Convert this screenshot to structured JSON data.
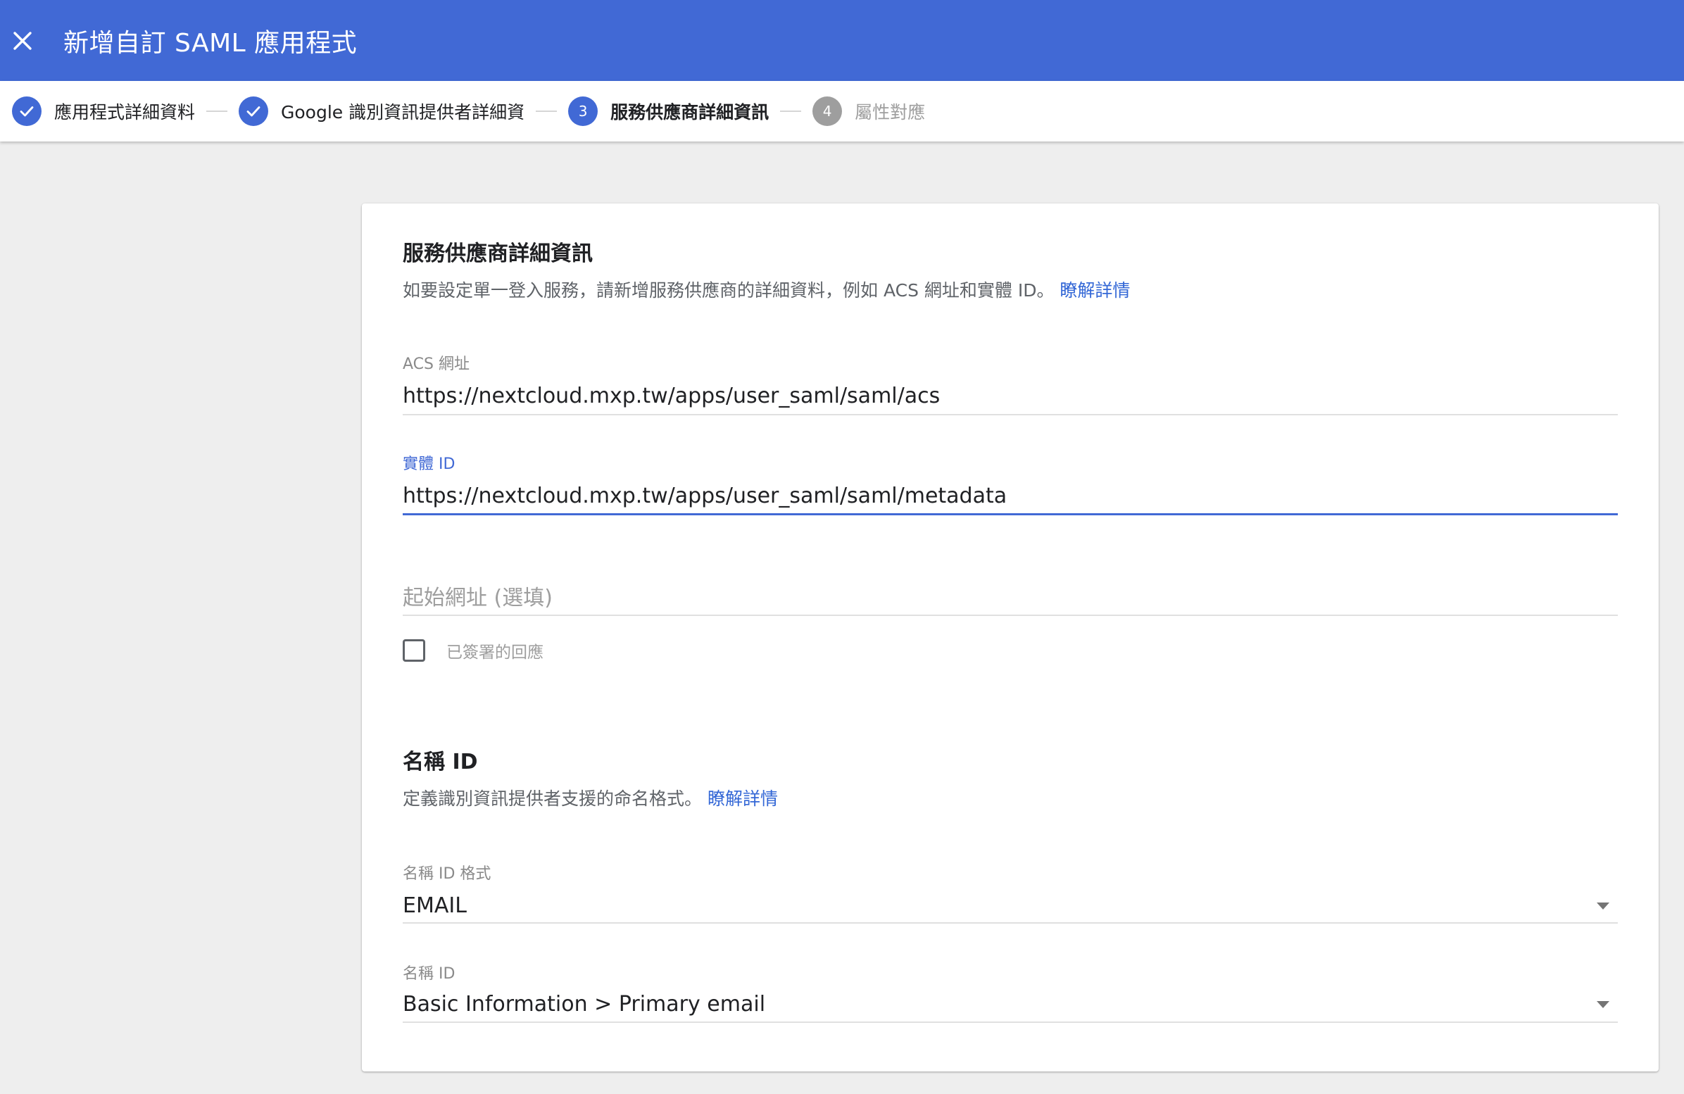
{
  "appbar": {
    "title": "新增自訂 SAML 應用程式",
    "close_icon": "close-icon"
  },
  "stepper": {
    "steps": [
      {
        "label": "應用程式詳細資料",
        "state": "done",
        "marker": "✓"
      },
      {
        "label": "Google 識別資訊提供者詳細資",
        "state": "done",
        "marker": "✓"
      },
      {
        "label": "服務供應商詳細資訊",
        "state": "active",
        "marker": "3"
      },
      {
        "label": "屬性對應",
        "state": "pending",
        "marker": "4"
      }
    ]
  },
  "service_provider": {
    "title": "服務供應商詳細資訊",
    "description": "如要設定單一登入服務，請新增服務供應商的詳細資料，例如 ACS 網址和實體 ID。",
    "learn_more": "瞭解詳情",
    "acs_label": "ACS 網址",
    "acs_value": "https://nextcloud.mxp.tw/apps/user_saml/saml/acs",
    "entity_label": "實體 ID",
    "entity_value": "https://nextcloud.mxp.tw/apps/user_saml/saml/metadata",
    "start_url_placeholder": "起始網址 (選填)",
    "signed_response_label": "已簽署的回應",
    "signed_response_checked": false
  },
  "name_id": {
    "title": "名稱 ID",
    "description": "定義識別資訊提供者支援的命名格式。",
    "learn_more": "瞭解詳情",
    "format_label": "名稱 ID 格式",
    "format_value": "EMAIL",
    "name_id_label": "名稱 ID",
    "name_id_value": "Basic Information > Primary email"
  },
  "colors": {
    "brand_blue": "#4169d5",
    "link_blue": "#3367d6",
    "pending_gray": "#9e9e9e"
  }
}
